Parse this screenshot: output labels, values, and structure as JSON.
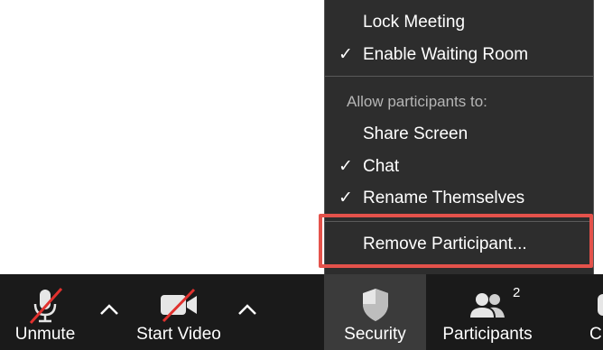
{
  "menu": {
    "items": [
      {
        "label": "Lock Meeting",
        "checked": false
      },
      {
        "label": "Enable Waiting Room",
        "checked": true
      }
    ],
    "section_header": "Allow participants to:",
    "allow_items": [
      {
        "label": "Share Screen",
        "checked": false
      },
      {
        "label": "Chat",
        "checked": true
      },
      {
        "label": "Rename Themselves",
        "checked": true
      }
    ],
    "remove_label": "Remove Participant...",
    "check_glyph": "✓",
    "highlight_color": "#e4524b"
  },
  "toolbar": {
    "unmute_label": "Unmute",
    "start_video_label": "Start Video",
    "security_label": "Security",
    "participants_label": "Participants",
    "participants_count": "2",
    "cut_label": "C"
  },
  "icons": [
    "microphone-muted-icon",
    "video-muted-icon",
    "caret-up-icon",
    "shield-icon",
    "participants-icon"
  ]
}
